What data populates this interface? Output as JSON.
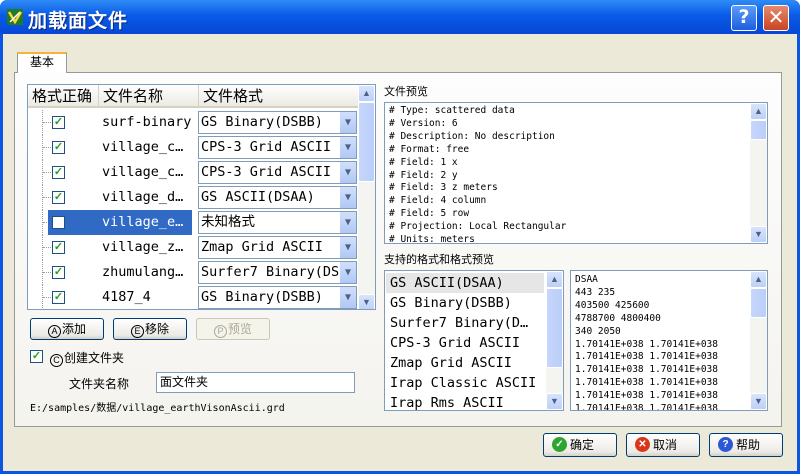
{
  "window": {
    "title": "加载面文件",
    "help_glyph": "?",
    "close_glyph": "✕"
  },
  "tab": {
    "label": "基本"
  },
  "file_table": {
    "headers": [
      "格式正确",
      "文件名称",
      "文件格式"
    ],
    "rows": [
      {
        "checked": true,
        "name": "surf-binary",
        "format": "GS Binary(DSBB)",
        "selected": false
      },
      {
        "checked": true,
        "name": "village_c…",
        "format": "CPS-3 Grid ASCII",
        "selected": false
      },
      {
        "checked": true,
        "name": "village_c…",
        "format": "CPS-3 Grid ASCII",
        "selected": false
      },
      {
        "checked": true,
        "name": "village_d…",
        "format": "GS ASCII(DSAA)",
        "selected": false
      },
      {
        "checked": false,
        "name": "village_e…",
        "format": "未知格式",
        "selected": true
      },
      {
        "checked": true,
        "name": "village_z…",
        "format": "Zmap Grid ASCII",
        "selected": false
      },
      {
        "checked": true,
        "name": "zhumulang…",
        "format": "Surfer7 Binary(DS",
        "selected": false
      },
      {
        "checked": true,
        "name": "4187_4",
        "format": "GS Binary(DSBB)",
        "selected": false
      }
    ]
  },
  "buttons": {
    "add": {
      "key": "A",
      "label": "添加"
    },
    "remove": {
      "key": "E",
      "label": "移除"
    },
    "preview": {
      "key": "P",
      "label": "预览"
    }
  },
  "create_folder": {
    "key": "C",
    "label": "创建文件夹",
    "checked": true
  },
  "folder_name": {
    "label": "文件夹名称",
    "value": "面文件夹"
  },
  "path": "E:/samples/数据/village_earthVisonAscii.grd",
  "file_preview": {
    "label": "文件预览",
    "text": "# Type: scattered data\n# Version: 6\n# Description: No description\n# Format: free\n# Field: 1 x\n# Field: 2 y\n# Field: 3 z meters\n# Field: 4 column\n# Field: 5 row\n# Projection: Local Rectangular\n# Units: meters"
  },
  "formats": {
    "label": "支持的格式和格式预览",
    "items": [
      "GS ASCII(DSAA)",
      "GS Binary(DSBB)",
      "Surfer7 Binary(D…",
      "CPS-3 Grid ASCII",
      "Zmap Grid ASCII",
      "Irap Classic ASCII",
      "Irap Rms ASCII"
    ],
    "current_index": 0,
    "preview_text": "DSAA\n443 235\n403500 425600\n4788700 4800400\n340 2050\n1.70141E+038 1.70141E+038\n1.70141E+038 1.70141E+038\n1.70141E+038 1.70141E+038\n1.70141E+038 1.70141E+038\n1.70141E+038 1.70141E+038\n1.70141E+038 1.70141E+038"
  },
  "dialog_buttons": {
    "ok": {
      "label": "确定",
      "color": "#2ea52e",
      "glyph": "✓"
    },
    "cancel": {
      "label": "取消",
      "color": "#d9361c",
      "glyph": "✕"
    },
    "help": {
      "label": "帮助",
      "color": "#2b59d6",
      "glyph": "?"
    }
  }
}
